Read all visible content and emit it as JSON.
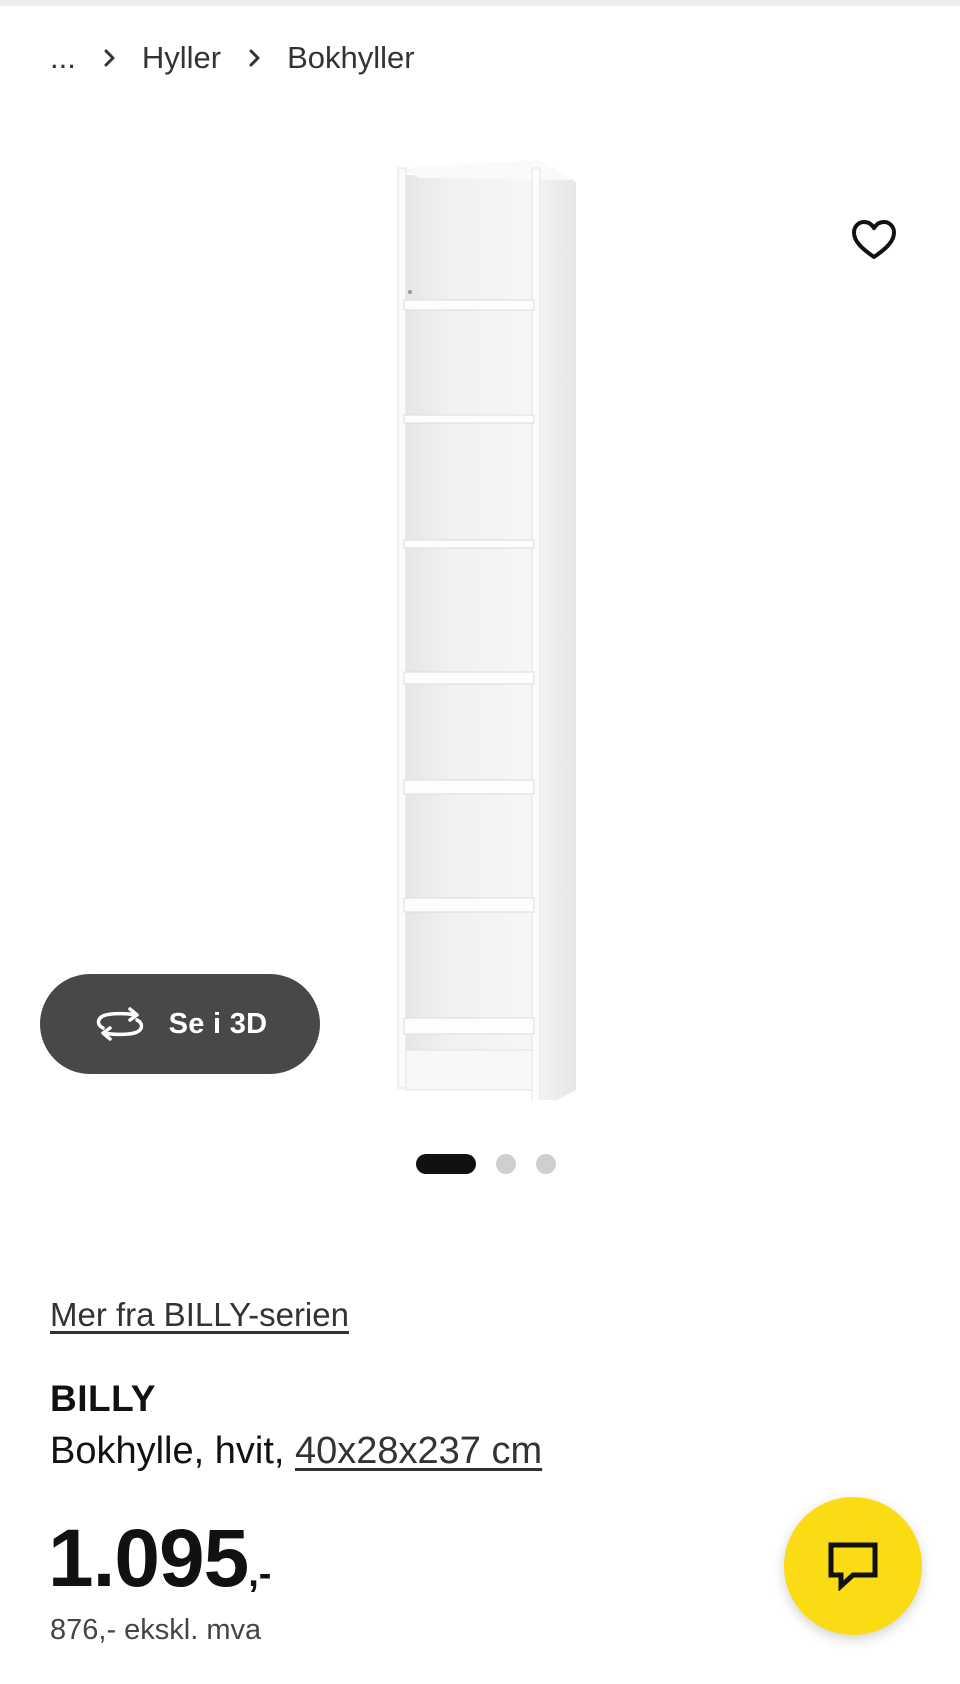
{
  "breadcrumb": {
    "ellipsis": "...",
    "items": [
      {
        "label": "Hyller"
      },
      {
        "label": "Bokhyller"
      }
    ],
    "separator_icon": "chevron-right-icon"
  },
  "gallery": {
    "favorite_icon": "heart-outline-icon",
    "view_3d_label": "Se i 3D",
    "view_3d_icon": "rotate-3d-icon",
    "dots_total": 3,
    "active_dot": 0
  },
  "product": {
    "series_link": "Mer fra BILLY-serien",
    "name": "BILLY",
    "description": "Bokhylle, hvit, ",
    "dimensions": "40x28x237 cm",
    "price_amount": "1.095",
    "price_suffix": ",-",
    "price_ex_vat": "876,- ekskl. mva"
  },
  "chat": {
    "icon": "chat-bubble-icon",
    "color": "#fadb14"
  },
  "colors": {
    "text": "#111111",
    "button_3d_bg": "#484848",
    "dot_active": "#111111",
    "dot_inactive": "#cfcfcf"
  }
}
